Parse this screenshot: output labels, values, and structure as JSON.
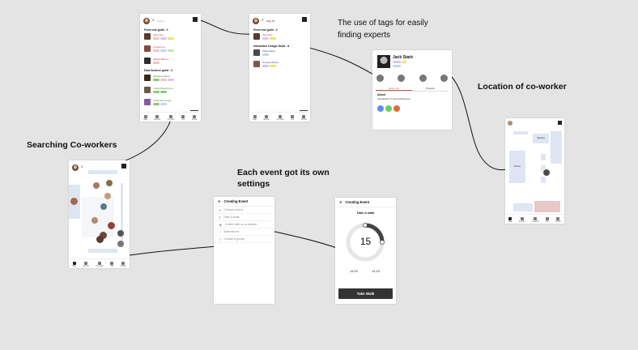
{
  "captions": {
    "tags": "The use of tags for easily",
    "tags_line2": "finding experts",
    "location": "Location of co-worker",
    "searching": "Searching Co-workers",
    "event": "Each event got its own",
    "event_line2": "settings"
  },
  "screen1": {
    "group1": "Front end guild - 3",
    "people1": [
      "Jane Doe",
      "Arnold Lee",
      "Marcel Barney"
    ],
    "group2": "Data Science guild - 3",
    "people2": [
      "Wolfgang Bauer",
      "Ludwig Beethoven",
      "Frederick Dengis"
    ],
    "nav": [
      "Map",
      "Events",
      "Co-work",
      "Info",
      "Profile"
    ]
  },
  "screen2": {
    "search_value": "Tags 50",
    "group1": "Front end guild - 3",
    "people1": [
      "Jane Doe"
    ],
    "group2": "Interaction Design Guild - 8",
    "people2": [
      "Mark Dalton",
      "Georgia Banks"
    ],
    "nav": [
      "Map",
      "Events",
      "Co-work",
      "Info",
      "Profile"
    ]
  },
  "profile": {
    "name": "Jack Stark",
    "tab_about": "About me",
    "tab_projects": "Projects",
    "about_title": "About",
    "about_text": "Operations IT and Architecture"
  },
  "event_list": {
    "title": "Creating Event",
    "items": [
      "Custom event",
      "Take a walk",
      "Coffee with a co-worker",
      "Brainstorm",
      "Create a group"
    ]
  },
  "event_walk": {
    "title": "Creating Event",
    "subtitle": "Take a walk",
    "minutes": "15",
    "start": "14:00",
    "end": "14:15",
    "button": "Take Walk"
  },
  "map_screen": {
    "room_label": "Meeting",
    "zone_label": "Worker"
  }
}
